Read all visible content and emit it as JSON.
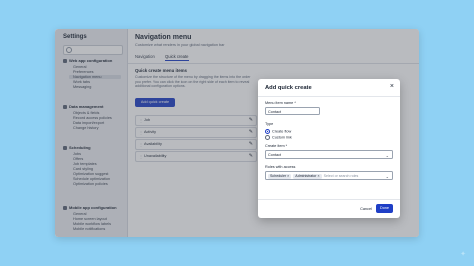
{
  "sidebar": {
    "title": "Settings",
    "sections": [
      {
        "label": "Web app configuration",
        "items": [
          "General",
          "Preferences",
          "Navigation menu",
          "Work tabs",
          "Messaging"
        ]
      },
      {
        "label": "Data management",
        "items": [
          "Objects & fields",
          "Record access policies",
          "Data import/export",
          "Change history"
        ]
      },
      {
        "label": "Scheduling",
        "items": [
          "Jobs",
          "Offers",
          "Job templates",
          "Card styling",
          "Optimization suggest",
          "Schedule optimization",
          "Optimization policies"
        ]
      },
      {
        "label": "Mobile app configuration",
        "items": [
          "General",
          "Home screen layout",
          "Mobile workflow labels",
          "Mobile notifications"
        ]
      }
    ],
    "active_item": "Navigation menu"
  },
  "main": {
    "title": "Navigation menu",
    "subtitle": "Customize what renders in your global navigation bar",
    "tabs": [
      {
        "label": "Navigation"
      },
      {
        "label": "Quick create"
      }
    ],
    "section_title": "Quick create menu items",
    "section_desc": "Customize the structure of the menu by dragging the items into the order you prefer. You can click the icon on the right side of each item to reveal additional configuration options.",
    "add_button": "Add quick create",
    "items": [
      "Job",
      "Activity",
      "Availability",
      "Unavailability"
    ]
  },
  "dialog": {
    "title": "Add quick create",
    "name_label": "Menu item name *",
    "name_value": "Contact",
    "type_label": "Type",
    "type_options": [
      "Create flow",
      "Custom link"
    ],
    "type_selected": "Create flow",
    "create_label": "Create item *",
    "create_value": "Contact",
    "roles_label": "Roles with access",
    "roles": [
      "Scheduler",
      "Administrator"
    ],
    "roles_placeholder": "Select or search roles",
    "cancel": "Cancel",
    "done": "Done"
  },
  "colors": {
    "accent": "#1f3fc6",
    "background": "#8fd1f4"
  },
  "icons": [
    "search-icon",
    "close-icon",
    "chevron-down-icon",
    "edit-icon",
    "drag-handle-icon"
  ]
}
